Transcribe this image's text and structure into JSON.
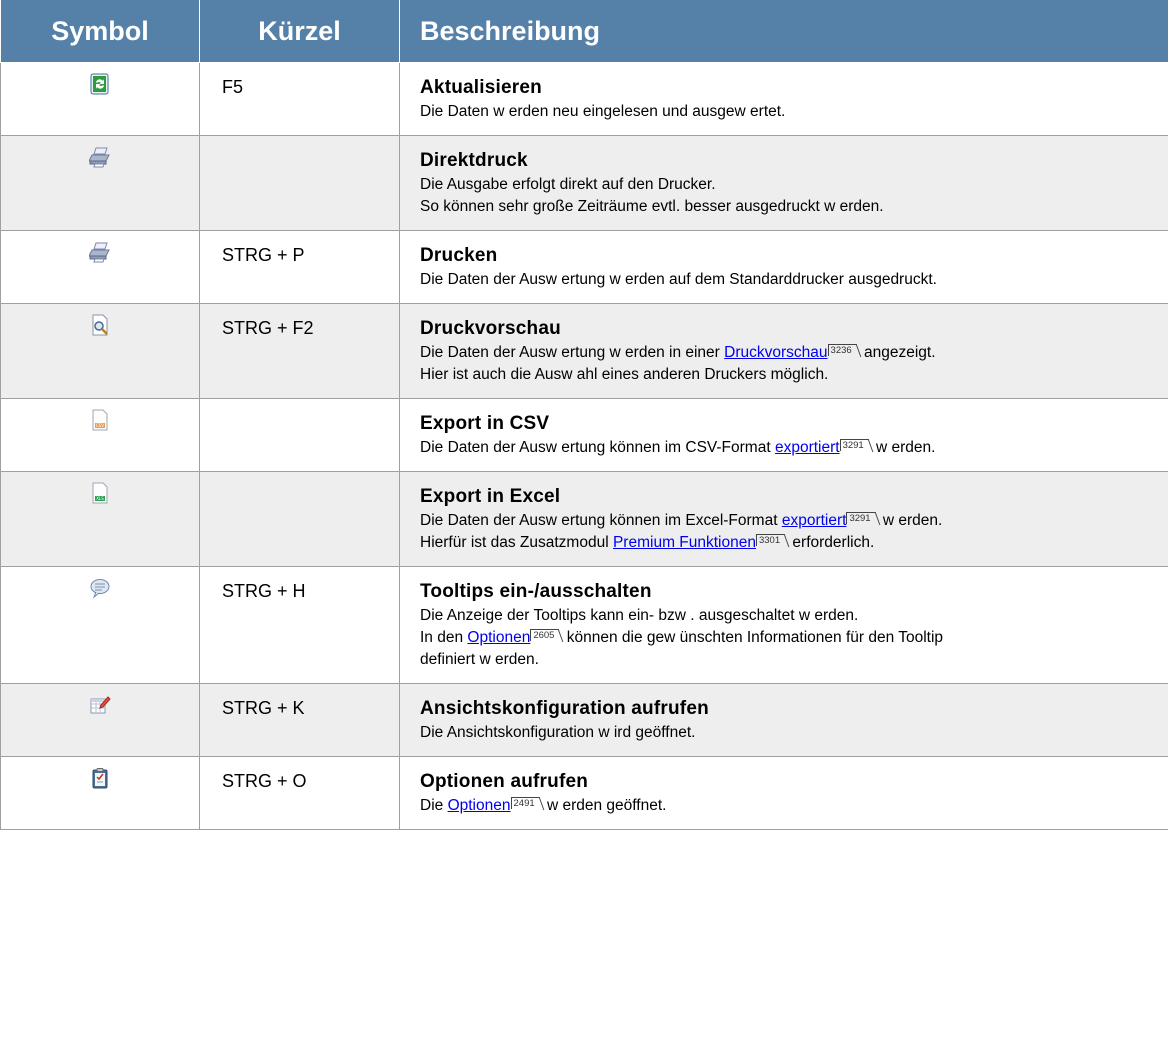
{
  "headers": {
    "symbol": "Symbol",
    "kuerzel": "Kürzel",
    "beschreibung": "Beschreibung"
  },
  "rows": [
    {
      "icon": "refresh-icon",
      "shortcut": "F5",
      "title": "Aktualisieren",
      "lines": [
        [
          {
            "t": "Die Daten w erden neu eingelesen und ausgew ertet."
          }
        ]
      ]
    },
    {
      "icon": "printer-icon",
      "shortcut": "",
      "title": "Direktdruck",
      "lines": [
        [
          {
            "t": "Die Ausgabe erfolgt direkt auf den Drucker."
          }
        ],
        [
          {
            "t": "So können sehr große Zeiträume evtl. besser ausgedruckt w erden."
          }
        ]
      ]
    },
    {
      "icon": "printer-icon",
      "shortcut": "STRG + P",
      "title": "Drucken",
      "lines": [
        [
          {
            "t": "Die Daten der Ausw ertung w erden auf dem Standarddrucker ausgedruckt."
          }
        ]
      ]
    },
    {
      "icon": "print-preview-icon",
      "shortcut": "STRG + F2",
      "title": "Druckvorschau",
      "lines": [
        [
          {
            "t": "Die Daten der Ausw ertung w erden in einer "
          },
          {
            "link": "Druckvorschau",
            "ref": "3236"
          },
          {
            "t": " angezeigt."
          }
        ],
        [
          {
            "t": "Hier ist auch die Ausw ahl eines anderen Druckers möglich."
          }
        ]
      ]
    },
    {
      "icon": "csv-file-icon",
      "shortcut": "",
      "title": "Export in CSV",
      "lines": [
        [
          {
            "t": "Die Daten der Ausw ertung können im CSV-Format "
          },
          {
            "link": "exportiert",
            "ref": "3291"
          },
          {
            "t": " w erden."
          }
        ]
      ]
    },
    {
      "icon": "excel-file-icon",
      "shortcut": "",
      "title": "Export in Excel",
      "lines": [
        [
          {
            "t": "Die Daten der Ausw ertung können im Excel-Format "
          },
          {
            "link": "exportiert",
            "ref": "3291"
          },
          {
            "t": " w erden."
          }
        ],
        [
          {
            "t": "Hierfür ist das Zusatzmodul "
          },
          {
            "link": "Premium Funktionen",
            "ref": "3301"
          },
          {
            "t": " erforderlich."
          }
        ]
      ]
    },
    {
      "icon": "speech-bubble-icon",
      "shortcut": "STRG + H",
      "title": "Tooltips ein-/ausschalten",
      "lines": [
        [
          {
            "t": "Die Anzeige der Tooltips kann ein- bzw . ausgeschaltet w erden."
          }
        ],
        [
          {
            "t": "In den "
          },
          {
            "link": "Optionen",
            "ref": "2605"
          },
          {
            "t": " können die gew ünschten Informationen für den Tooltip"
          }
        ],
        [
          {
            "t": "definiert w erden."
          }
        ]
      ]
    },
    {
      "icon": "grid-edit-icon",
      "shortcut": "STRG + K",
      "title": "Ansichtskonfiguration aufrufen",
      "lines": [
        [
          {
            "t": "Die Ansichtskonfiguration w ird geöffnet."
          }
        ]
      ]
    },
    {
      "icon": "clipboard-options-icon",
      "shortcut": "STRG + O",
      "title": "Optionen aufrufen",
      "lines": [
        [
          {
            "t": "Die "
          },
          {
            "link": "Optionen",
            "ref": "2491"
          },
          {
            "t": " w erden geöffnet."
          }
        ]
      ]
    }
  ]
}
